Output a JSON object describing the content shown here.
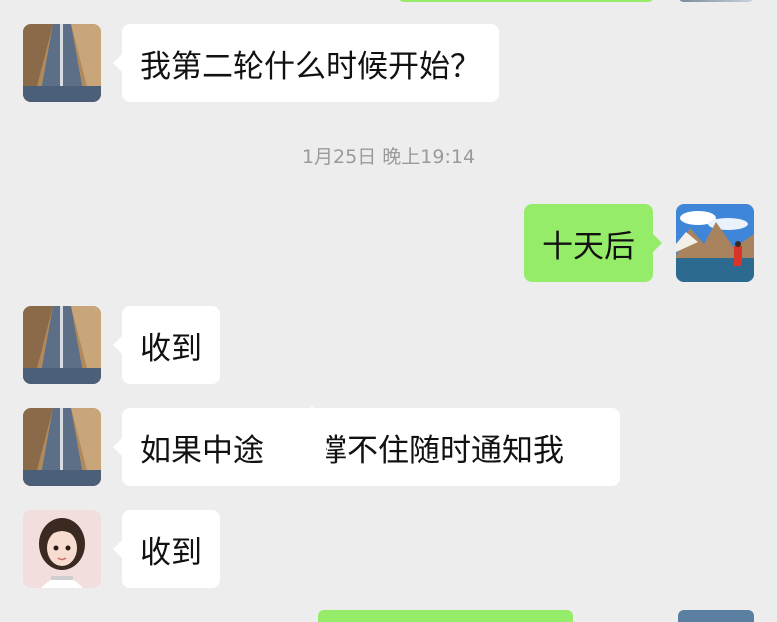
{
  "conversation": {
    "timestamp": "1月25日 晚上19:14",
    "messages": [
      {
        "sender": "contact",
        "avatar": "road-avatar",
        "text": "我第二轮什么时候开始？"
      },
      {
        "sender": "self",
        "avatar": "lake-mountain-avatar",
        "text": "十天后"
      },
      {
        "sender": "contact",
        "avatar": "road-avatar",
        "text": "收到"
      },
      {
        "sender": "contact",
        "avatar": "road-avatar",
        "text_before": "如果中途",
        "text_after": "撑不住随时通知我"
      },
      {
        "sender": "contact2",
        "avatar": "cartoon-girl-avatar",
        "text": "收到"
      }
    ]
  },
  "colors": {
    "background": "#ededed",
    "incoming_bubble": "#ffffff",
    "outgoing_bubble": "#95ec69",
    "timestamp_text": "#9a9a9a"
  }
}
